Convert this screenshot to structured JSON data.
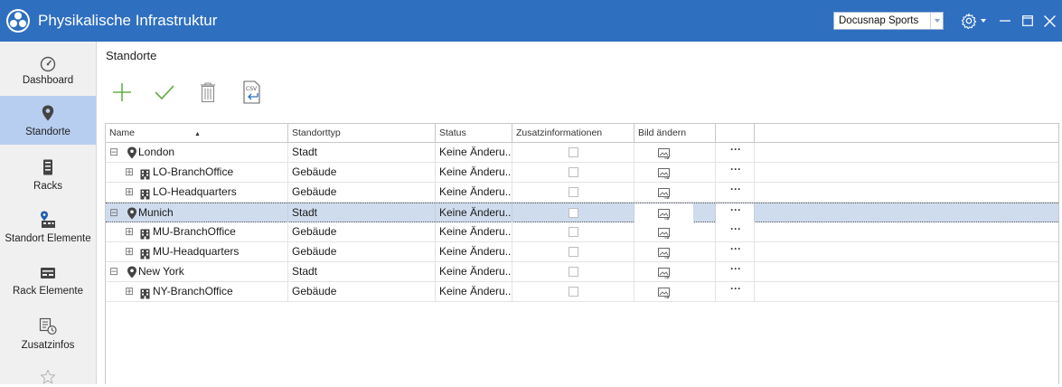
{
  "window": {
    "title": "Physikalische Infrastruktur",
    "workspace": "Docusnap Sports",
    "accent": "#2f6fc0"
  },
  "sidebar": {
    "items": [
      {
        "label": "Dashboard",
        "icon": "gauge-icon"
      },
      {
        "label": "Standorte",
        "icon": "map-pin-icon",
        "active": true
      },
      {
        "label": "Racks",
        "icon": "server-rack-icon"
      },
      {
        "label": "Standort Elemente",
        "icon": "location-elements-icon"
      },
      {
        "label": "Rack Elemente",
        "icon": "rack-elements-icon"
      },
      {
        "label": "Zusatzinfos",
        "icon": "additional-info-icon"
      },
      {
        "label": "",
        "icon": "star-icon"
      }
    ]
  },
  "page": {
    "title": "Standorte"
  },
  "toolbar": {
    "add": "add-icon",
    "apply": "checkmark-icon",
    "delete": "trash-icon",
    "import": "csv-import-icon"
  },
  "table": {
    "columns": [
      "Name",
      "Standorttyp",
      "Status",
      "Zusatzinformationen",
      "Bild ändern"
    ],
    "rows": [
      {
        "name": "London",
        "type": "Stadt",
        "status": "Keine Änderu...",
        "level": 0
      },
      {
        "name": "LO-BranchOffice",
        "type": "Gebäude",
        "status": "Keine Änderu...",
        "level": 1
      },
      {
        "name": "LO-Headquarters",
        "type": "Gebäude",
        "status": "Keine Änderu...",
        "level": 1
      },
      {
        "name": "Munich",
        "type": "Stadt",
        "status": "Keine Änderu...",
        "level": 0,
        "selected": true
      },
      {
        "name": "MU-BranchOffice",
        "type": "Gebäude",
        "status": "Keine Änderu...",
        "level": 1
      },
      {
        "name": "MU-Headquarters",
        "type": "Gebäude",
        "status": "Keine Änderu...",
        "level": 1
      },
      {
        "name": "New York",
        "type": "Stadt",
        "status": "Keine Änderu...",
        "level": 0
      },
      {
        "name": "NY-BranchOffice",
        "type": "Gebäude",
        "status": "Keine Änderu...",
        "level": 1
      }
    ],
    "more_label": "···",
    "expander": "⊟",
    "expander_child": "⊞"
  }
}
